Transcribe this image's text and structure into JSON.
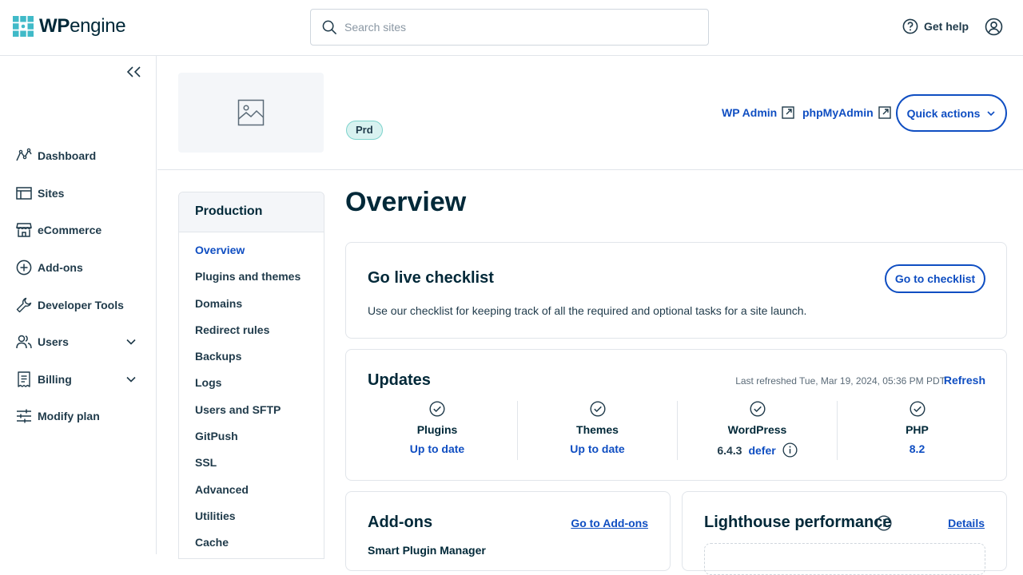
{
  "header": {
    "logo_bold": "WP",
    "logo_light": "engine",
    "search_placeholder": "Search sites",
    "get_help": "Get help"
  },
  "sidebar": {
    "items": [
      {
        "label": "Dashboard",
        "icon": "dashboard-icon"
      },
      {
        "label": "Sites",
        "icon": "sites-icon"
      },
      {
        "label": "eCommerce",
        "icon": "store-icon"
      },
      {
        "label": "Add-ons",
        "icon": "plus-circle-icon"
      },
      {
        "label": "Developer Tools",
        "icon": "wrench-icon"
      },
      {
        "label": "Users",
        "icon": "users-icon"
      },
      {
        "label": "Billing",
        "icon": "billing-icon"
      },
      {
        "label": "Modify plan",
        "icon": "sliders-icon"
      }
    ]
  },
  "site": {
    "env_badge": "Prd",
    "wp_admin": "WP Admin",
    "phpmyadmin": "phpMyAdmin",
    "quick_actions": "Quick actions"
  },
  "envmenu": {
    "title": "Production",
    "items": [
      "Overview",
      "Plugins and themes",
      "Domains",
      "Redirect rules",
      "Backups",
      "Logs",
      "Users and SFTP",
      "GitPush",
      "SSL",
      "Advanced",
      "Utilities",
      "Cache"
    ]
  },
  "main": {
    "title": "Overview",
    "checklist": {
      "title": "Go live checklist",
      "button": "Go to checklist",
      "description": "Use our checklist for keeping track of all the required and optional tasks for a site launch."
    },
    "updates": {
      "title": "Updates",
      "last_refreshed": "Last refreshed Tue, Mar 19, 2024, 05:36 PM PDT",
      "refresh": "Refresh",
      "columns": [
        {
          "name": "Plugins",
          "status": "Up to date"
        },
        {
          "name": "Themes",
          "status": "Up to date"
        },
        {
          "name": "WordPress",
          "version": "6.4.3",
          "status": "defer"
        },
        {
          "name": "PHP",
          "status": "8.2"
        }
      ]
    },
    "addons": {
      "title": "Add-ons",
      "link": "Go to Add-ons",
      "first_item": "Smart Plugin Manager"
    },
    "lighthouse": {
      "title": "Lighthouse performance",
      "link": "Details"
    }
  },
  "colors": {
    "accent": "#0f4ec2",
    "brand": "#40bac8",
    "dark": "#002838"
  }
}
